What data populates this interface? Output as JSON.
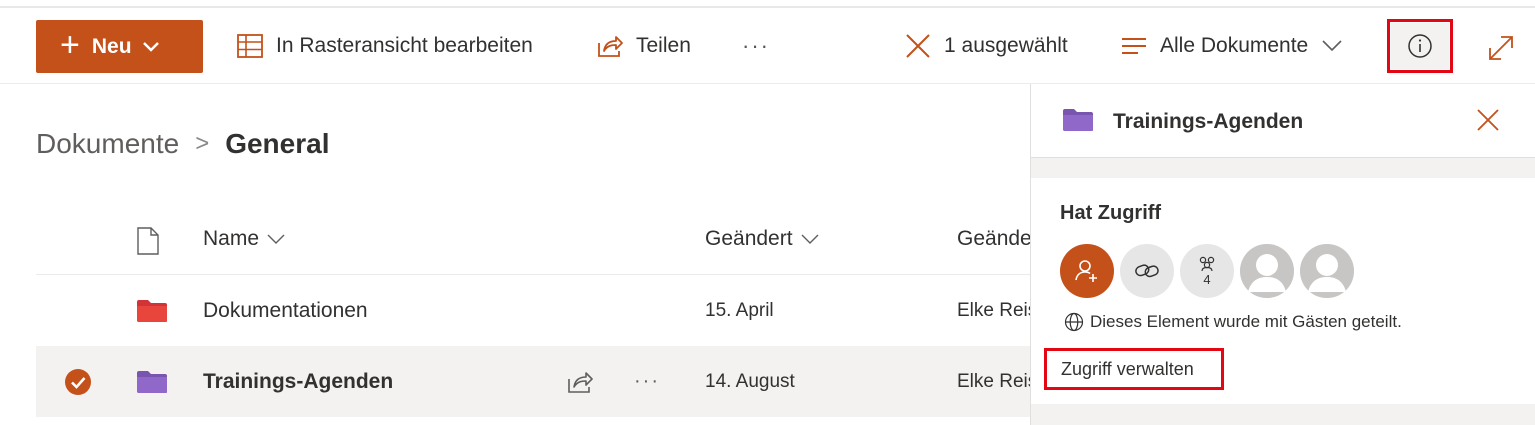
{
  "toolbar": {
    "new_label": "Neu",
    "edit_grid_label": "In Rasteransicht bearbeiten",
    "share_label": "Teilen",
    "more_label": "···",
    "selected_label": "1 ausgewählt",
    "view_label": "Alle Dokumente",
    "info_icon": "info-icon",
    "expand_icon": "expand-icon"
  },
  "breadcrumb": {
    "root": "Dokumente",
    "separator": ">",
    "current": "General"
  },
  "list": {
    "columns": {
      "name": "Name",
      "modified": "Geändert",
      "modified_by": "Geände"
    },
    "rows": [
      {
        "name": "Dokumentationen",
        "modified": "15. April",
        "modified_by": "Elke Reis",
        "folder_color": "#d13438",
        "selected": false
      },
      {
        "name": "Trainings-Agenden",
        "modified": "14. August",
        "modified_by": "Elke Reis",
        "folder_color": "#8764b8",
        "selected": true
      }
    ],
    "row_more_label": "···"
  },
  "details_panel": {
    "title": "Trainings-Agenden",
    "folder_color": "#8764b8",
    "access_heading": "Hat Zugriff",
    "group_count": "4",
    "guest_note": "Dieses Element wurde mit Gästen geteilt.",
    "manage_access_label": "Zugriff verwalten"
  },
  "colors": {
    "accent": "#c4501a",
    "highlight_box": "#e30613",
    "selected_row": "#f3f2f1"
  }
}
